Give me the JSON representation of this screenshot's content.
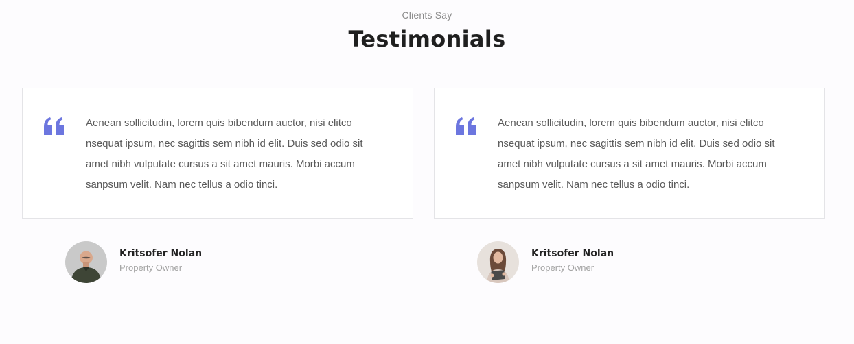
{
  "section": {
    "eyebrow": "Clients Say",
    "title": "Testimonials"
  },
  "testimonials": [
    {
      "quote": "Aenean sollicitudin, lorem quis bibendum auctor, nisi elitco nsequat ipsum, nec sagittis sem nibh id elit. Duis sed odio sit amet nibh vulputate cursus a sit amet mauris. Morbi accum sanpsum velit. Nam nec tellus a odio tinci.",
      "author_name": "Kritsofer Nolan",
      "author_role": "Property Owner",
      "avatar_icon": "man-portrait-icon"
    },
    {
      "quote": "Aenean sollicitudin, lorem quis bibendum auctor, nisi elitco nsequat ipsum, nec sagittis sem nibh id elit. Duis sed odio sit amet nibh vulputate cursus a sit amet mauris. Morbi accum sanpsum velit. Nam nec tellus a odio tinci.",
      "author_name": "Kritsofer Nolan",
      "author_role": "Property Owner",
      "avatar_icon": "woman-portrait-icon"
    }
  ],
  "colors": {
    "accent": "#6c76df",
    "background": "#fdfcfe",
    "card_border": "#e4e4e7",
    "title": "#1f1f1f",
    "muted": "#a3a3a3"
  }
}
